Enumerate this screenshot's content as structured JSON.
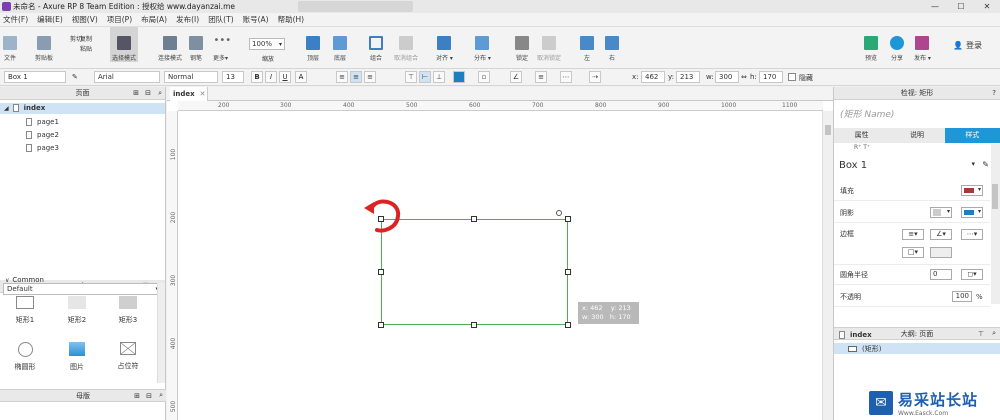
{
  "window": {
    "title": "未命名 - Axure RP 8 Team Edition : 授权给 www.dayanzai.me"
  },
  "menu": [
    "文件(F)",
    "编辑(E)",
    "视图(V)",
    "项目(P)",
    "布局(A)",
    "发布(I)",
    "团队(T)",
    "账号(A)",
    "帮助(H)"
  ],
  "toolbar": {
    "file": "文件",
    "clipboard": "剪贴板",
    "cut": "剪切",
    "copy": "复制",
    "paste": "粘贴",
    "select": "选择模式",
    "connect": "连接模式",
    "pen": "钢笔",
    "more": "更多▾",
    "zoom_value": "100%",
    "zoom_label": "缩放",
    "top": "顶层",
    "bottom": "底层",
    "group": "组合",
    "ungroup": "取消组合",
    "align": "对齐 ▾",
    "distribute": "分布 ▾",
    "lock": "锁定",
    "unlock": "取消锁定",
    "left": "左",
    "right": "右",
    "preview": "预览",
    "share": "分享",
    "publish": "发布 ▾",
    "login": "登录"
  },
  "format": {
    "widget_name": "Box 1",
    "font": "Arial",
    "style": "Normal",
    "size": "13",
    "bold": "B",
    "italic": "I",
    "underline": "U",
    "x_label": "x:",
    "x": "462",
    "y_label": "y:",
    "y": "213",
    "w_label": "w:",
    "w": "300",
    "h_label": "h:",
    "h": "170",
    "hidden": "隐藏"
  },
  "pages": {
    "header": "页面",
    "root": "index",
    "children": [
      "page1",
      "page2",
      "page3"
    ]
  },
  "library": {
    "header": "库",
    "selected": "Default",
    "group": "Common",
    "items": [
      "矩形1",
      "矩形2",
      "矩形3",
      "椭圆形",
      "图片",
      "占位符"
    ]
  },
  "masters": {
    "header": "母版"
  },
  "canvas": {
    "tab": "index",
    "hruler": [
      "200",
      "300",
      "400",
      "500",
      "600",
      "700",
      "800",
      "900",
      "1000",
      "1100"
    ],
    "vruler": [
      "100",
      "200",
      "300",
      "400",
      "500"
    ],
    "tooltip": {
      "line1": "x: 462    y: 213",
      "line2": "w: 300   h: 170"
    }
  },
  "inspector": {
    "header": "检视: 矩形",
    "name_placeholder": "(矩形 Name)",
    "tabs": [
      "属性",
      "说明",
      "样式"
    ],
    "marks": "R⁺            T⁺",
    "style_name": "Box 1",
    "fill": "填充",
    "shadow": "阴影",
    "border": "边框",
    "radius": "圆角半径",
    "radius_value": "0",
    "opacity": "不透明",
    "opacity_value": "100",
    "percent": "%"
  },
  "outline": {
    "header": "大纲: 页面",
    "root": "index",
    "child": "(矩形)"
  },
  "watermark": {
    "text": "易采站长站",
    "sub": "Www.Easck.Com"
  },
  "colors": {
    "accent": "#1e96d8",
    "fill": "#a33a3a",
    "shadow": "#1e7fc0",
    "selection": "#4caf50",
    "annotation": "#dd2222"
  }
}
